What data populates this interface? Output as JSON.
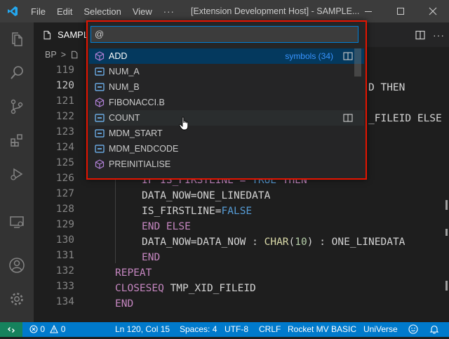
{
  "titlebar": {
    "menu": [
      "File",
      "Edit",
      "Selection",
      "View"
    ],
    "more": "···",
    "window_title": "[Extension Development Host] - SAMPLE..."
  },
  "tab": {
    "label": "SAMPL"
  },
  "breadcrumb": {
    "root": "BP",
    "sep": ">"
  },
  "editor": {
    "line_numbers": [
      "119",
      "120",
      "121",
      "122",
      "123",
      "124",
      "125",
      "126",
      "127",
      "128",
      "129",
      "130",
      "131",
      "132",
      "133",
      "134"
    ],
    "active_line": "120",
    "visible_fragments": {
      "l120": "D THEN",
      "l122": "_FILEID ELSE",
      "l126_a": "IF IS_FIRSTLINE = ",
      "l126_b": "TRUE",
      "l126_c": " THEN",
      "l127": "DATA_NOW=ONE_LINEDATA",
      "l128_a": "IS_FIRSTLINE=",
      "l128_b": "FALSE",
      "l129": "END ELSE",
      "l130_a": "DATA_NOW=DATA_NOW : ",
      "l130_b": "CHAR",
      "l130_c": "(",
      "l130_d": "10",
      "l130_e": ") : ONE_LINEDATA",
      "l131": "END",
      "l132": "REPEAT",
      "l133_a": "CLOSESEQ",
      "l133_b": " TMP_XID_FILEID",
      "l134": "END"
    }
  },
  "quick_pick": {
    "input_value": "@",
    "items": [
      {
        "label": "ADD",
        "icon": "method-cube",
        "description": "symbols (34)",
        "selected": true
      },
      {
        "label": "NUM_A",
        "icon": "variable"
      },
      {
        "label": "NUM_B",
        "icon": "variable"
      },
      {
        "label": "FIBONACCI.B",
        "icon": "method-cube"
      },
      {
        "label": "COUNT",
        "icon": "variable",
        "hover": true
      },
      {
        "label": "MDM_START",
        "icon": "variable"
      },
      {
        "label": "MDM_ENDCODE",
        "icon": "variable"
      },
      {
        "label": "PREINITIALISE",
        "icon": "method-cube"
      }
    ]
  },
  "statusbar": {
    "errors": "0",
    "warnings": "0",
    "position": "Ln 120, Col 15",
    "spaces": "Spaces: 4",
    "encoding": "UTF-8",
    "eol": "CRLF",
    "language": "Rocket MV BASIC",
    "server": "UniVerse"
  },
  "colors": {
    "accent": "#007acc",
    "highlight_border": "#e51400",
    "selection": "#04395e",
    "keyword": "#c586c0",
    "function": "#dcdcaa",
    "number": "#b5cea8",
    "constant": "#569cd6"
  }
}
